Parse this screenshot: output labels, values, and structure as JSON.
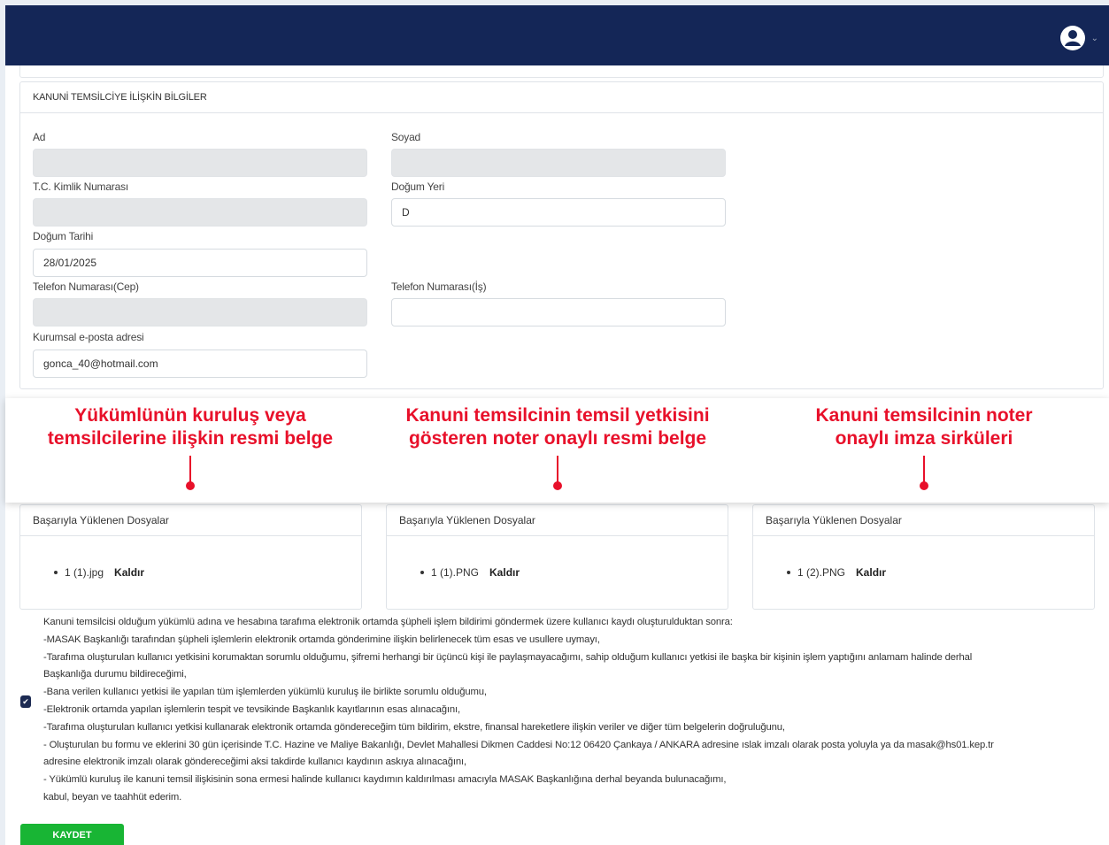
{
  "header": {
    "user_icon": "user-circle-icon",
    "brand_color": "#142657"
  },
  "representative_section": {
    "title": "KANUNİ TEMSİLCİYE İLİŞKİN BİLGİLER",
    "fields": {
      "ad": {
        "label": "Ad",
        "value": ""
      },
      "soyad": {
        "label": "Soyad",
        "value": ""
      },
      "tc_kimlik": {
        "label": "T.C. Kimlik Numarası",
        "value": ""
      },
      "dogum_yeri": {
        "label": "Doğum Yeri",
        "value": "D"
      },
      "dogum_tarihi": {
        "label": "Doğum Tarihi",
        "value": "28/01/2025"
      },
      "tel_cep": {
        "label": "Telefon Numarası(Cep)",
        "value": ""
      },
      "tel_is": {
        "label": "Telefon Numarası(İş)",
        "value": ""
      },
      "eposta": {
        "label": "Kurumsal e-posta adresi",
        "value": "gonca_40@hotmail.com"
      }
    }
  },
  "annotations": {
    "color": "#e8102a",
    "items": [
      {
        "line1": "Yükümlünün kuruluş veya",
        "line2": "temsilcilerine ilişkin resmi belge"
      },
      {
        "line1": "Kanuni temsilcinin temsil yetkisini",
        "line2": "gösteren noter onaylı resmi belge"
      },
      {
        "line1": "Kanuni temsilcinin noter",
        "line2": "onaylı imza sirküleri"
      }
    ]
  },
  "uploads": [
    {
      "title": "Başarıyla Yüklenen Dosyalar",
      "file": "1 (1).jpg",
      "remove_label": "Kaldır"
    },
    {
      "title": "Başarıyla Yüklenen Dosyalar",
      "file": "1 (1).PNG",
      "remove_label": "Kaldır"
    },
    {
      "title": "Başarıyla Yüklenen Dosyalar",
      "file": "1 (2).PNG",
      "remove_label": "Kaldır"
    }
  ],
  "terms": {
    "checked": true,
    "lines": [
      "Kanuni temsilcisi olduğum yükümlü adına ve hesabına tarafıma elektronik ortamda şüpheli işlem bildirimi göndermek üzere kullanıcı kaydı oluşturulduktan sonra:",
      "-MASAK Başkanlığı tarafından şüpheli işlemlerin elektronik ortamda gönderimine ilişkin belirlenecek tüm esas ve usullere uymayı,",
      "-Tarafıma oluşturulan kullanıcı yetkisini korumaktan sorumlu olduğumu, şifremi herhangi bir üçüncü kişi ile paylaşmayacağımı, sahip olduğum kullanıcı yetkisi ile başka bir kişinin işlem yaptığını anlamam halinde derhal",
      "Başkanlığa durumu bildireceğimi,",
      "-Bana verilen kullanıcı yetkisi ile yapılan tüm işlemlerden yükümlü kuruluş ile birlikte sorumlu olduğumu,",
      "-Elektronik ortamda yapılan işlemlerin tespit ve tevsikinde Başkanlık kayıtlarının esas alınacağını,",
      "-Tarafıma oluşturulan kullanıcı yetkisi kullanarak elektronik ortamda göndereceğim tüm bildirim, ekstre, finansal hareketlere ilişkin veriler ve diğer tüm belgelerin doğruluğunu,",
      "- Oluşturulan bu formu ve eklerini 30 gün içerisinde T.C. Hazine ve Maliye Bakanlığı, Devlet Mahallesi Dikmen Caddesi No:12 06420 Çankaya / ANKARA adresine ıslak imzalı olarak posta yoluyla ya da masak@hs01.kep.tr",
      "adresine elektronik imzalı olarak göndereceğimi aksi takdirde kullanıcı kaydının askıya alınacağını,",
      "- Yükümlü kuruluş ile kanuni temsil ilişkisinin sona ermesi halinde kullanıcı kaydımın kaldırılması amacıyla MASAK Başkanlığına derhal beyanda bulunacağımı,",
      "kabul, beyan ve taahhüt ederim."
    ]
  },
  "save_button": {
    "label": "KAYDET",
    "color": "#18b534"
  }
}
